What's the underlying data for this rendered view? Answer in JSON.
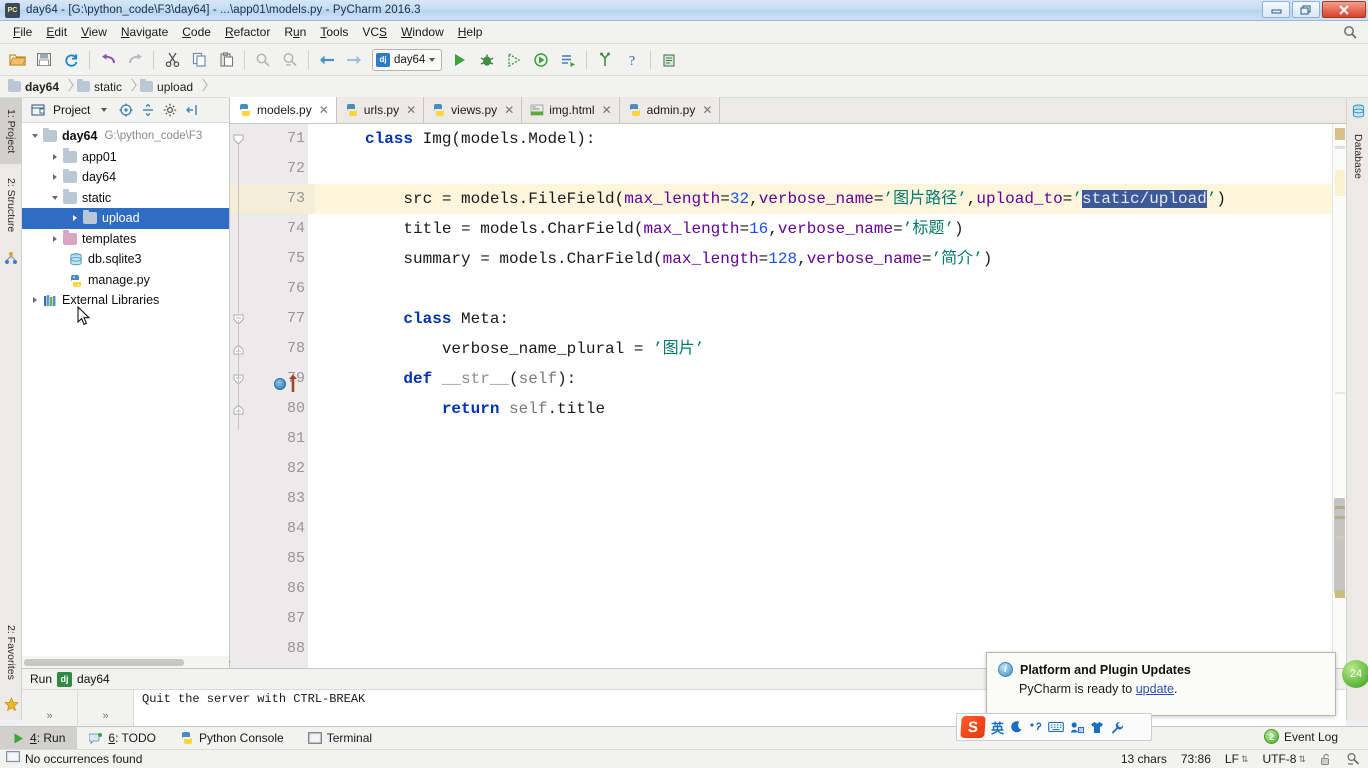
{
  "window": {
    "title": "day64 - [G:\\python_code\\F3\\day64] - ...\\app01\\models.py - PyCharm 2016.3",
    "app_icon": "pycharm-icon",
    "minimize": "–",
    "restore": "❐",
    "close": "✕"
  },
  "menubar": {
    "items": [
      {
        "label": "File",
        "mnemonic": "F"
      },
      {
        "label": "Edit",
        "mnemonic": "E"
      },
      {
        "label": "View",
        "mnemonic": "V"
      },
      {
        "label": "Navigate",
        "mnemonic": "N"
      },
      {
        "label": "Code",
        "mnemonic": "C"
      },
      {
        "label": "Refactor",
        "mnemonic": "R"
      },
      {
        "label": "Run",
        "mnemonic": "u"
      },
      {
        "label": "Tools",
        "mnemonic": "T"
      },
      {
        "label": "VCS",
        "mnemonic": "S"
      },
      {
        "label": "Window",
        "mnemonic": "W"
      },
      {
        "label": "Help",
        "mnemonic": "H"
      }
    ],
    "search_icon": "search-icon"
  },
  "toolbar": {
    "run_config_name": "day64",
    "icons": [
      "open-folder-icon",
      "save-all-icon",
      "sync-icon",
      "undo-icon",
      "redo-icon",
      "cut-icon",
      "copy-icon",
      "paste-icon",
      "find-icon",
      "replace-icon",
      "back-icon",
      "forward-icon"
    ],
    "run_icons": [
      "run-icon",
      "debug-icon",
      "coverage-icon",
      "profile-icon",
      "run-tests-icon",
      "attach-icon",
      "help-icon",
      "settings-icon"
    ]
  },
  "breadcrumb": {
    "items": [
      "day64",
      "static",
      "upload"
    ]
  },
  "left_strip": {
    "tabs": [
      "1: Project",
      "2: Structure",
      "2: Favorites"
    ]
  },
  "right_strip": {
    "tabs": [
      "Database"
    ]
  },
  "project_panel": {
    "title": "Project",
    "toolbar_icons": [
      "target-icon",
      "collapse-icon",
      "gear-icon",
      "hide-icon"
    ],
    "tree": [
      {
        "label": "day64",
        "path": "G:\\python_code\\F3",
        "depth": 0,
        "state": "open",
        "icon": "folder-icon",
        "bold": true,
        "selected": false
      },
      {
        "label": "app01",
        "path": "",
        "depth": 1,
        "state": "closed",
        "icon": "folder-icon",
        "bold": false,
        "selected": false
      },
      {
        "label": "day64",
        "path": "",
        "depth": 1,
        "state": "closed",
        "icon": "folder-icon",
        "bold": false,
        "selected": false
      },
      {
        "label": "static",
        "path": "",
        "depth": 1,
        "state": "open",
        "icon": "folder-icon",
        "bold": false,
        "selected": false
      },
      {
        "label": "upload",
        "path": "",
        "depth": 2,
        "state": "closed",
        "icon": "folder-icon",
        "bold": false,
        "selected": true
      },
      {
        "label": "templates",
        "path": "",
        "depth": 1,
        "state": "closed",
        "icon": "folder-pink-icon",
        "bold": false,
        "selected": false
      },
      {
        "label": "db.sqlite3",
        "path": "",
        "depth": 2,
        "state": "none",
        "icon": "database-file-icon",
        "bold": false,
        "selected": false
      },
      {
        "label": "manage.py",
        "path": "",
        "depth": 2,
        "state": "none",
        "icon": "python-file-icon",
        "bold": false,
        "selected": false
      },
      {
        "label": "External Libraries",
        "path": "",
        "depth": 0,
        "state": "closed",
        "icon": "libraries-icon",
        "bold": false,
        "selected": false
      }
    ]
  },
  "editor_tabs": [
    {
      "label": "models.py",
      "icon": "python-file-icon",
      "active": true
    },
    {
      "label": "urls.py",
      "icon": "python-file-icon",
      "active": false
    },
    {
      "label": "views.py",
      "icon": "python-file-icon",
      "active": false
    },
    {
      "label": "img.html",
      "icon": "html-file-icon",
      "active": false
    },
    {
      "label": "admin.py",
      "icon": "python-file-icon",
      "active": false
    }
  ],
  "editor": {
    "first_line": 71,
    "highlighted_line": 73,
    "breakpoint_line": 79,
    "lines": [
      {
        "n": 71,
        "tokens": [
          {
            "t": "class",
            "c": "k"
          },
          {
            "t": " Img(models.Model):",
            "c": "plain"
          }
        ],
        "indent": 0,
        "fold": "start"
      },
      {
        "n": 72,
        "tokens": [],
        "indent": 0
      },
      {
        "n": 73,
        "tokens": [
          {
            "t": "    src = models.FileField(",
            "c": "plain"
          },
          {
            "t": "max_length",
            "c": "p"
          },
          {
            "t": "=",
            "c": "plain"
          },
          {
            "t": "32",
            "c": "n"
          },
          {
            "t": ",",
            "c": "plain"
          },
          {
            "t": "verbose_name",
            "c": "p"
          },
          {
            "t": "=",
            "c": "plain"
          },
          {
            "t": "’图片路径’",
            "c": "s"
          },
          {
            "t": ",",
            "c": "plain"
          },
          {
            "t": "upload_to",
            "c": "p"
          },
          {
            "t": "=",
            "c": "plain"
          },
          {
            "t": "’",
            "c": "s"
          },
          {
            "t": "static/upload",
            "c": "sel"
          },
          {
            "t": "’",
            "c": "s"
          },
          {
            "t": ")",
            "c": "plain"
          }
        ]
      },
      {
        "n": 74,
        "tokens": [
          {
            "t": "    title = models.CharField(",
            "c": "plain"
          },
          {
            "t": "max_length",
            "c": "p"
          },
          {
            "t": "=",
            "c": "plain"
          },
          {
            "t": "16",
            "c": "n"
          },
          {
            "t": ",",
            "c": "plain"
          },
          {
            "t": "verbose_name",
            "c": "p"
          },
          {
            "t": "=",
            "c": "plain"
          },
          {
            "t": "’标题’",
            "c": "s"
          },
          {
            "t": ")",
            "c": "plain"
          }
        ]
      },
      {
        "n": 75,
        "tokens": [
          {
            "t": "    summary = models.CharField(",
            "c": "plain"
          },
          {
            "t": "max_length",
            "c": "p"
          },
          {
            "t": "=",
            "c": "plain"
          },
          {
            "t": "128",
            "c": "n"
          },
          {
            "t": ",",
            "c": "plain"
          },
          {
            "t": "verbose_name",
            "c": "p"
          },
          {
            "t": "=",
            "c": "plain"
          },
          {
            "t": "’简介’",
            "c": "s"
          },
          {
            "t": ")",
            "c": "plain"
          }
        ]
      },
      {
        "n": 76,
        "tokens": []
      },
      {
        "n": 77,
        "tokens": [
          {
            "t": "    ",
            "c": "plain"
          },
          {
            "t": "class",
            "c": "k"
          },
          {
            "t": " Meta:",
            "c": "plain"
          }
        ],
        "fold": "start"
      },
      {
        "n": 78,
        "tokens": [
          {
            "t": "        verbose_name_plural = ",
            "c": "plain"
          },
          {
            "t": "’图片’",
            "c": "s"
          }
        ],
        "fold": "end"
      },
      {
        "n": 79,
        "tokens": [
          {
            "t": "    ",
            "c": "plain"
          },
          {
            "t": "def",
            "c": "k"
          },
          {
            "t": " ",
            "c": "plain"
          },
          {
            "t": "__str__",
            "c": "fn"
          },
          {
            "t": "(",
            "c": "plain"
          },
          {
            "t": "self",
            "c": "df"
          },
          {
            "t": "):",
            "c": "plain"
          }
        ],
        "fold": "start"
      },
      {
        "n": 80,
        "tokens": [
          {
            "t": "        ",
            "c": "plain"
          },
          {
            "t": "return",
            "c": "k"
          },
          {
            "t": " ",
            "c": "plain"
          },
          {
            "t": "self",
            "c": "df"
          },
          {
            "t": ".title",
            "c": "plain"
          }
        ],
        "fold": "end"
      },
      {
        "n": 81,
        "tokens": []
      },
      {
        "n": 82,
        "tokens": []
      },
      {
        "n": 83,
        "tokens": []
      },
      {
        "n": 84,
        "tokens": []
      },
      {
        "n": 85,
        "tokens": []
      },
      {
        "n": 86,
        "tokens": []
      },
      {
        "n": 87,
        "tokens": []
      },
      {
        "n": 88,
        "tokens": []
      }
    ]
  },
  "run_panel": {
    "label": "Run",
    "config": "day64",
    "config_icon": "django-icon",
    "output": "Quit the server with CTRL-BREAK"
  },
  "bottom_tabs": [
    {
      "label": "4: Run",
      "mnemonic": "4",
      "icon": "run-icon",
      "active": true
    },
    {
      "label": "6: TODO",
      "mnemonic": "6",
      "icon": "todo-icon",
      "active": false
    },
    {
      "label": "Python Console",
      "mnemonic": "",
      "icon": "python-console-icon",
      "active": false
    },
    {
      "label": "Terminal",
      "mnemonic": "",
      "icon": "terminal-icon",
      "active": false
    }
  ],
  "statusbar": {
    "message": "No occurrences found",
    "message_icon": "info-box-icon",
    "chars": "13 chars",
    "caret": "73:86",
    "line_sep": "LF",
    "encoding": "UTF-8",
    "lock_icon": "unlocked-icon",
    "inspect_icon": "inspector-icon"
  },
  "notification": {
    "icon": "info-icon",
    "title": "Platform and Plugin Updates",
    "body_prefix": "PyCharm is ready to ",
    "link": "update",
    "body_suffix": "."
  },
  "event_log": {
    "count": "2",
    "label": "Event Log"
  },
  "ime": {
    "brand": "S",
    "mode": "英",
    "icons": [
      "moon-icon",
      "comma-icon",
      "keyboard-icon",
      "input-method-icon",
      "skin-icon",
      "wrench-icon"
    ]
  },
  "colors": {
    "selection_bg": "#3c5a9a",
    "tree_selection_bg": "#2f6cc4",
    "highlight_line": "#fdf6dd",
    "keyword": "#0033b3",
    "string": "#007a6d",
    "param": "#660099",
    "number": "#1750eb",
    "titlebar": "#c5dbf2"
  }
}
